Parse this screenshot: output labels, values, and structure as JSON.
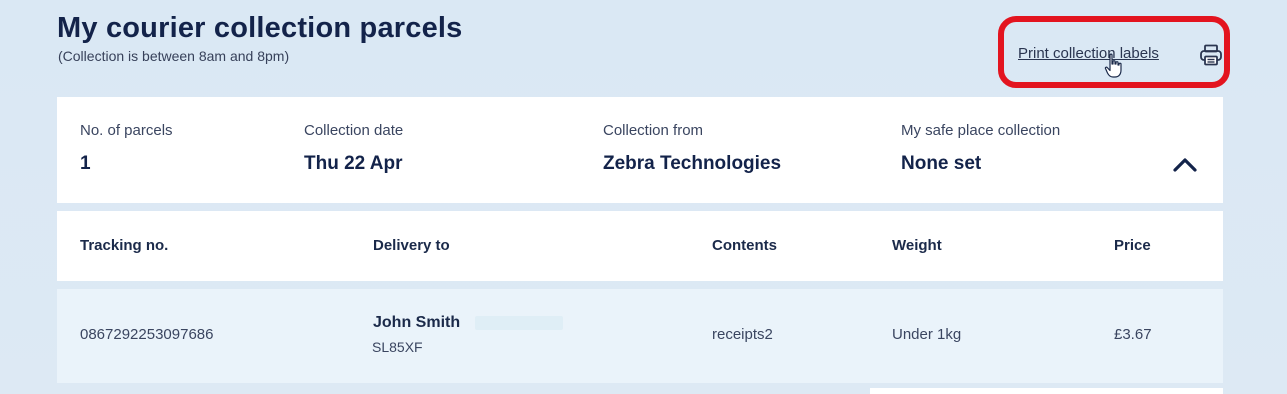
{
  "header": {
    "title": "My courier collection parcels",
    "subtitle": "(Collection is between 8am and 8pm)",
    "print_label": "Print collection labels"
  },
  "icons": {
    "printer": "printer-icon",
    "cursor": "hand-pointer-icon",
    "collapse": "chevron-up-icon"
  },
  "colors": {
    "highlight": "#e3141f",
    "title": "#13234a",
    "background": "#dae8f4"
  },
  "summary": {
    "parcels_label": "No. of parcels",
    "parcels_value": "1",
    "date_label": "Collection date",
    "date_value": "Thu 22 Apr",
    "from_label": "Collection from",
    "from_value": "Zebra Technologies",
    "safe_label": "My safe place collection",
    "safe_value": "None set"
  },
  "table": {
    "headers": {
      "tracking": "Tracking no.",
      "delivery": "Delivery to",
      "contents": "Contents",
      "weight": "Weight",
      "price": "Price"
    },
    "rows": [
      {
        "tracking": "0867292253097686",
        "name": "John Smith",
        "postcode": "SL85XF",
        "contents": "receipts2",
        "weight": "Under 1kg",
        "price": "£3.67"
      }
    ]
  }
}
